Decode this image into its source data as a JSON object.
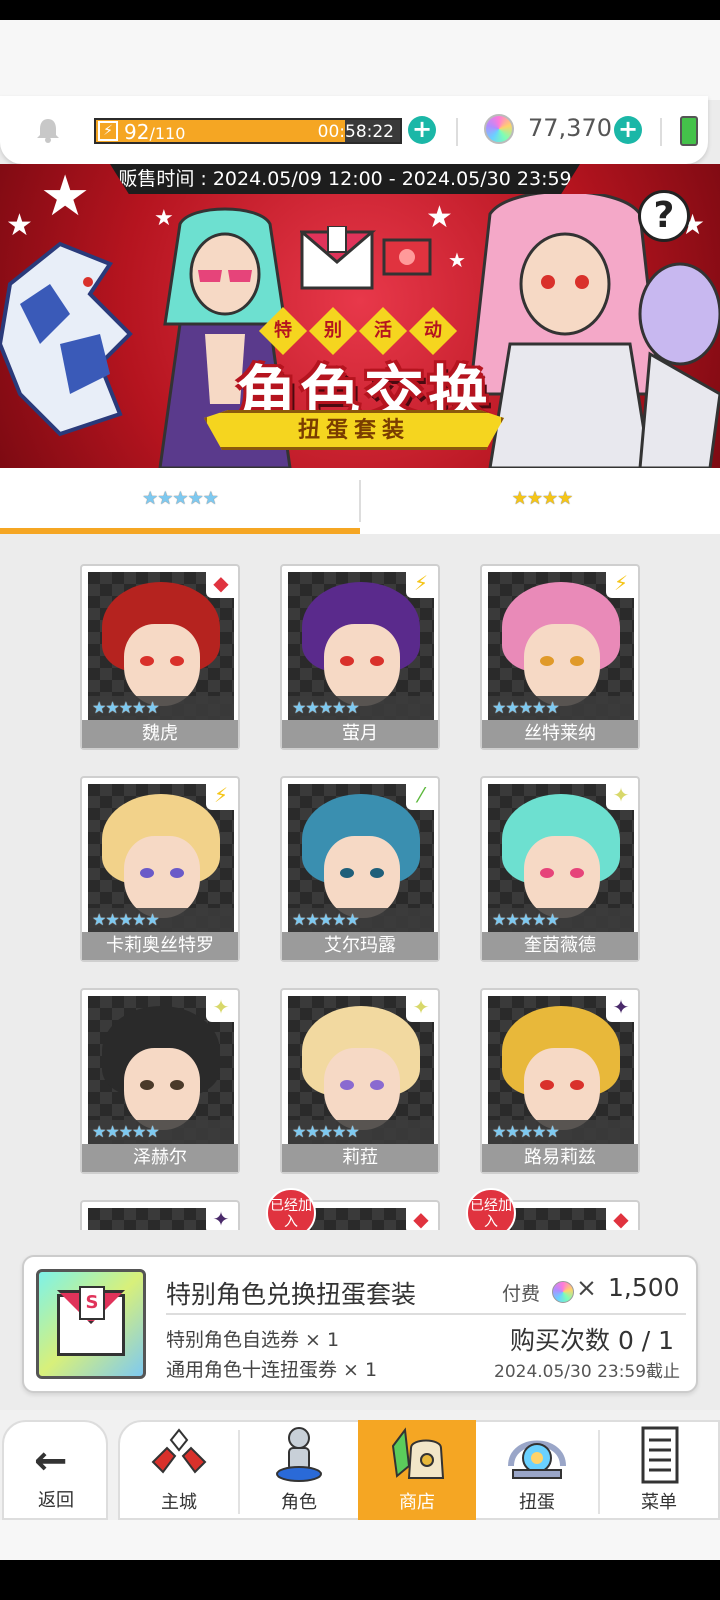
{
  "resources": {
    "energy_current": "92",
    "energy_max": "/110",
    "energy_timer": "00:58:22",
    "energy_fill_fraction": 0.82,
    "gems": "77,370"
  },
  "banner": {
    "sale_period": "贩售时间 : 2024.05/09 12:00 - 2024.05/30 23:59",
    "tag_chars": [
      "特",
      "别",
      "活",
      "动"
    ],
    "title": "角色交换",
    "subtitle": "扭蛋套装",
    "help": "?"
  },
  "tabs": [
    {
      "label": "★★★★★",
      "active": true
    },
    {
      "label": "★★★★",
      "active": false
    }
  ],
  "characters": [
    {
      "name": "魏虎",
      "stars": "★★★★★",
      "element": "diamond",
      "element_glyph": "◆",
      "element_color": "#e0333f",
      "hair": "#b5231f",
      "eye": "#d9312b"
    },
    {
      "name": "萤月",
      "stars": "★★★★★",
      "element": "lightning",
      "element_glyph": "⚡",
      "element_color": "#f5c518",
      "hair": "#5a2a8c",
      "eye": "#d9312b"
    },
    {
      "name": "丝特莱纳",
      "stars": "★★★★★",
      "element": "lightning",
      "element_glyph": "⚡",
      "element_color": "#f5c518",
      "hair": "#e98ab8",
      "eye": "#e09a2a"
    },
    {
      "name": "卡莉奥丝特罗",
      "stars": "★★★★★",
      "element": "lightning",
      "element_glyph": "⚡",
      "element_color": "#f5c518",
      "hair": "#f2d28a",
      "eye": "#6a5ac8"
    },
    {
      "name": "艾尔玛露",
      "stars": "★★★★★",
      "element": "wind",
      "element_glyph": "⁄",
      "element_color": "#5bb83b",
      "hair": "#3a8fb0",
      "eye": "#1f5f7a"
    },
    {
      "name": "奎茵薇德",
      "stars": "★★★★★",
      "element": "light",
      "element_glyph": "✦",
      "element_color": "#d8d86a",
      "hair": "#6de0d0",
      "eye": "#e6447a"
    },
    {
      "name": "泽赫尔",
      "stars": "★★★★★",
      "element": "light",
      "element_glyph": "✦",
      "element_color": "#d8d86a",
      "hair": "#2a2a2a",
      "eye": "#4a3a2a"
    },
    {
      "name": "莉菈",
      "stars": "★★★★★",
      "element": "light",
      "element_glyph": "✦",
      "element_color": "#d8d86a",
      "hair": "#f2d9a0",
      "eye": "#8a6ad0"
    },
    {
      "name": "路易莉兹",
      "stars": "★★★★★",
      "element": "dark",
      "element_glyph": "✦",
      "element_color": "#4a2a6a",
      "hair": "#e8b83a",
      "eye": "#d9312b"
    }
  ],
  "partial_row": [
    {
      "badge": "",
      "element_glyph": "✦",
      "element_color": "#4a2a6a"
    },
    {
      "badge": "已经加入",
      "element_glyph": "◆",
      "element_color": "#e0333f"
    },
    {
      "badge": "已经加入",
      "element_glyph": "◆",
      "element_color": "#e0333f"
    }
  ],
  "package": {
    "title": "特别角色兑换扭蛋套装",
    "cost_label": "付费",
    "cost_x": "×",
    "cost": "1,500",
    "items": [
      "特别角色自选券 × 1",
      "通用角色十连扭蛋券 × 1"
    ],
    "purchase_count": "购买次数 0 / 1",
    "deadline": "2024.05/30 23:59截止",
    "icon_letter": "S"
  },
  "nav": {
    "back": "返回",
    "items": [
      {
        "label": "主城",
        "active": false
      },
      {
        "label": "角色",
        "active": false
      },
      {
        "label": "商店",
        "active": true
      },
      {
        "label": "扭蛋",
        "active": false
      },
      {
        "label": "菜单",
        "active": false
      }
    ]
  }
}
